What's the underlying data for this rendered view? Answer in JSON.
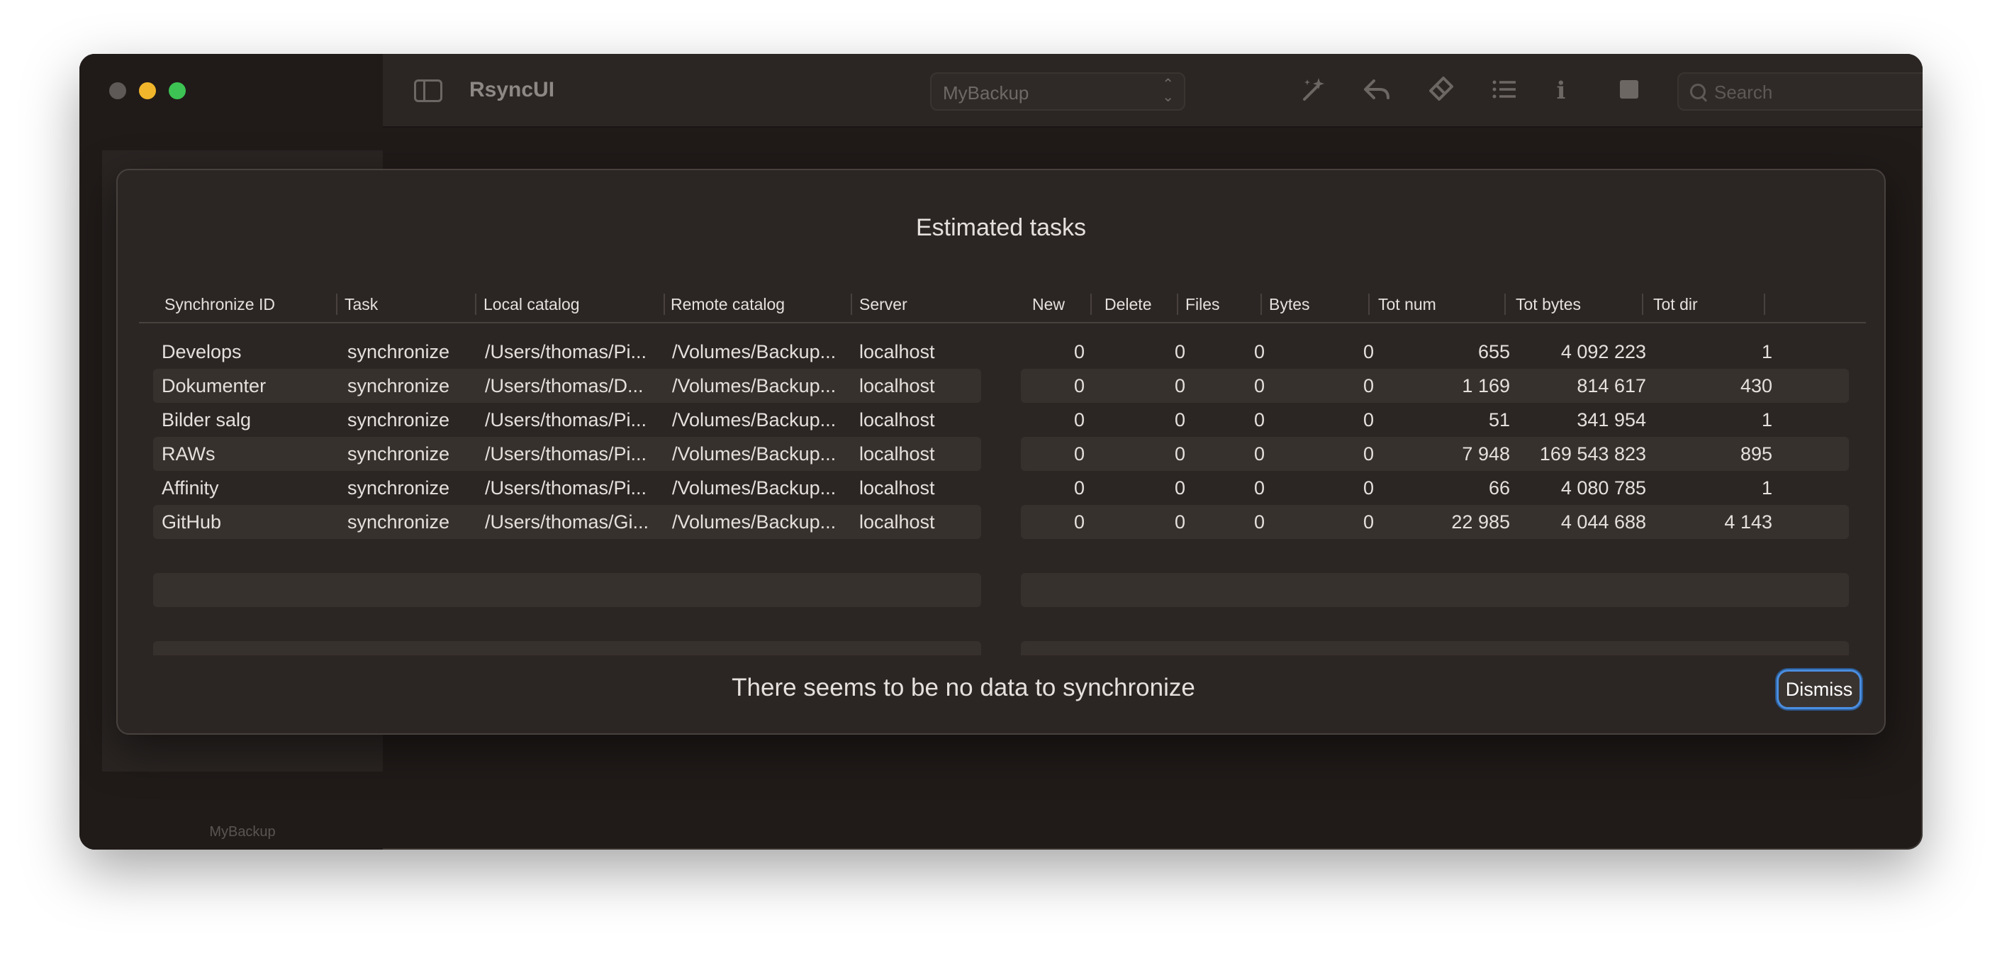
{
  "app": {
    "title": "RsyncUI"
  },
  "toolbar": {
    "profile_selected": "MyBackup",
    "search_placeholder": "Search",
    "icons": [
      "sidebar-toggle-icon",
      "magic-wand-icon",
      "undo-arrow-icon",
      "eraser-icon",
      "list-icon",
      "info-icon",
      "stop-square-icon",
      "search-icon"
    ]
  },
  "sidebar": {
    "profile_label": "MyBackup"
  },
  "sheet": {
    "title": "Estimated tasks",
    "message": "There seems to be no data to synchronize",
    "dismiss_label": "Dismiss"
  },
  "left_table": {
    "columns": [
      "Synchronize ID",
      "Task",
      "Local catalog",
      "Remote catalog",
      "Server"
    ],
    "rows": [
      [
        "Develops",
        "synchronize",
        "/Users/thomas/Pi...",
        "/Volumes/Backup...",
        "localhost"
      ],
      [
        "Dokumenter",
        "synchronize",
        "/Users/thomas/D...",
        "/Volumes/Backup...",
        "localhost"
      ],
      [
        "Bilder salg",
        "synchronize",
        "/Users/thomas/Pi...",
        "/Volumes/Backup...",
        "localhost"
      ],
      [
        "RAWs",
        "synchronize",
        "/Users/thomas/Pi...",
        "/Volumes/Backup...",
        "localhost"
      ],
      [
        "Affinity",
        "synchronize",
        "/Users/thomas/Pi...",
        "/Volumes/Backup...",
        "localhost"
      ],
      [
        "GitHub",
        "synchronize",
        "/Users/thomas/Gi...",
        "/Volumes/Backup...",
        "localhost"
      ]
    ]
  },
  "right_table": {
    "columns": [
      "New",
      "Delete",
      "Files",
      "Bytes",
      "Tot num",
      "Tot bytes",
      "Tot dir"
    ],
    "rows": [
      [
        "0",
        "0",
        "0",
        "0",
        "655",
        "4 092 223",
        "1"
      ],
      [
        "0",
        "0",
        "0",
        "0",
        "1 169",
        "814 617",
        "430"
      ],
      [
        "0",
        "0",
        "0",
        "0",
        "51",
        "341 954",
        "1"
      ],
      [
        "0",
        "0",
        "0",
        "0",
        "7 948",
        "169 543 823",
        "895"
      ],
      [
        "0",
        "0",
        "0",
        "0",
        "66",
        "4 080 785",
        "1"
      ],
      [
        "0",
        "0",
        "0",
        "0",
        "22 985",
        "4 044 688",
        "4 143"
      ]
    ]
  },
  "colors": {
    "window_bg": "#201b19",
    "sheet_bg": "#2b2624",
    "row_alt": "#37312e",
    "accent": "#4a8ee0",
    "traffic_min": "#f0b52b",
    "traffic_max": "#3dc353"
  }
}
